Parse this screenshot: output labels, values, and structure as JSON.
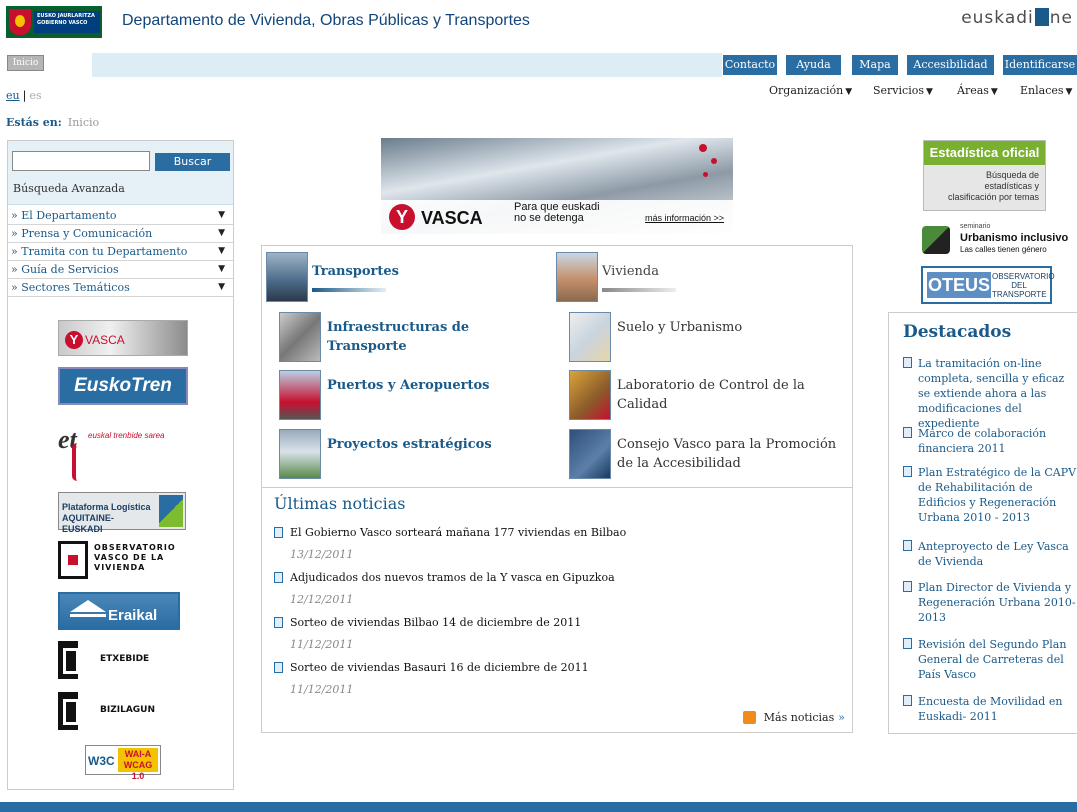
{
  "header": {
    "gov_logo_text": "EUSKO JAURLARITZA GOBIERNO VASCO",
    "department_title": "Departamento de Vivienda, Obras Públicas y Transportes",
    "portal_logo_a": "euskadi",
    "portal_logo_b": "ne"
  },
  "topbar": {
    "home_label": "Inicio",
    "links": [
      "Contacto",
      "Ayuda",
      "Mapa",
      "Accesibilidad",
      "Identificarse"
    ]
  },
  "lang": {
    "eu": "eu",
    "separator": "|",
    "es": "es"
  },
  "menus": [
    "Organización",
    "Servicios",
    "Áreas",
    "Enlaces"
  ],
  "breadcrumb": {
    "label": "Estás en:",
    "current": "Inicio"
  },
  "search": {
    "input_value": "",
    "button_label": "Buscar",
    "advanced_label": "Búsqueda Avanzada"
  },
  "leftnav": [
    "» El Departamento",
    "» Prensa y Comunicación",
    "» Tramita con tu Departamento",
    "» Guía de Servicios",
    "» Sectores Temáticos"
  ],
  "partner_logos": {
    "vasca_y": "Y",
    "vasca": "VASCA",
    "euskotren": "EuskoTren",
    "ets": "euskal trenbide sarea",
    "ets_mark": "et",
    "plataforma": "Plataforma Logística AQUITAINE-EUSKADI",
    "observatorio": "OBSERVATORIO VASCO DE LA VIVIENDA",
    "eraikal": "Eraikal",
    "etxebide": "ETXEBIDE",
    "bizilagun": "BIZILAGUN",
    "w3c": "W3C",
    "wai": "WAI-A WCAG 1.0"
  },
  "banner": {
    "brand_y": "Y",
    "brand": "VASCA",
    "claim": "Para que euskadi no se detenga",
    "more": "más información >>"
  },
  "areas": {
    "transportes": "Transportes",
    "vivienda": "Vivienda",
    "items_left": [
      "Infraestructuras de Transporte",
      "Puertos y Aeropuertos",
      "Proyectos estratégicos"
    ],
    "items_right": [
      "Suelo y Urbanismo",
      "Laboratorio de Control de la Calidad",
      "Consejo Vasco para la Promoción de la Accesibilidad"
    ]
  },
  "news": {
    "title": "Últimas noticias",
    "items": [
      {
        "title": "El Gobierno Vasco sorteará mañana 177 viviendas en Bilbao",
        "date": "13/12/2011"
      },
      {
        "title": "Adjudicados dos nuevos tramos de la Y vasca en Gipuzkoa",
        "date": "12/12/2011"
      },
      {
        "title": "Sorteo de viviendas Bilbao 14 de diciembre de 2011",
        "date": "11/12/2011"
      },
      {
        "title": "Sorteo de viviendas Basauri 16 de diciembre de 2011",
        "date": "11/12/2011"
      }
    ],
    "more_label": "Más noticias",
    "more_chevron": "»"
  },
  "right": {
    "estadistica_title": "Estadística oficial",
    "estadistica_sub": "Búsqueda de estadísticas y clasificación por temas",
    "urbanismo_small": "seminario",
    "urbanismo_title": "Urbanismo inclusivo",
    "urbanismo_sub": "Las calles tienen género",
    "oteus_logo": "OTEUS",
    "oteus_text": "OBSERVATORIO DEL TRANSPORTE"
  },
  "destacados": {
    "title": "Destacados",
    "items": [
      "La tramitación on-line completa, sencilla y eficaz se extiende ahora a las modificaciones del expediente",
      "Marco de colaboración financiera 2011",
      "Plan Estratégico de la CAPV de Rehabilitación de Edificios y Regeneración Urbana 2010 - 2013",
      "Anteproyecto de Ley Vasca de Vivienda",
      "Plan Director de Vivienda y Regeneración Urbana 2010-2013",
      "Revisión del Segundo Plan General de Carreteras del País Vasco",
      "Encuesta de Movilidad en Euskadi- 2011"
    ]
  },
  "colors": {
    "accent": "#2a6da3",
    "brand_red": "#c8102e",
    "green": "#7ab02f"
  }
}
